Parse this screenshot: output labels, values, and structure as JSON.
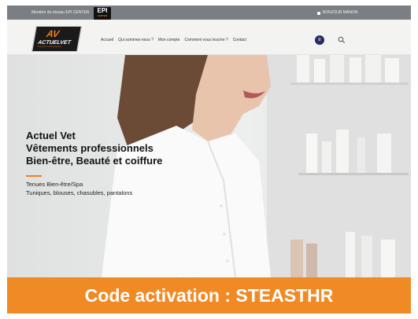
{
  "topbar": {
    "member_text": "Membre du réseau EPI CENTER",
    "epi_logo": "EPI",
    "epi_sub": "CENTER",
    "user_greeting": "BONJOUR MANON"
  },
  "nav": {
    "logo_mark": "AV",
    "logo_name": "ACTUELVET",
    "logo_tag": "VÊTEMENTS PROFESSIONNELS",
    "items": [
      "Accueil",
      "Qui sommes-nous ?",
      "Mon compte",
      "Comment vous inscrire ?",
      "Contact"
    ]
  },
  "hero": {
    "title_line1": "Actuel Vet",
    "title_line2": "Vêtements professionnels",
    "title_line3": "Bien-être, Beauté et coiffure",
    "sub_line1": "Tenues Bien-être/Spa",
    "sub_line2": "Tuniques, blouses, chasubles, pantalons",
    "slides": 4,
    "active_slide": 1
  },
  "banner": {
    "text": "Code activation : STEASTHR"
  },
  "colors": {
    "accent": "#f08a24",
    "nav_cart": "#1f2c73",
    "topbar": "#7b7e82"
  }
}
